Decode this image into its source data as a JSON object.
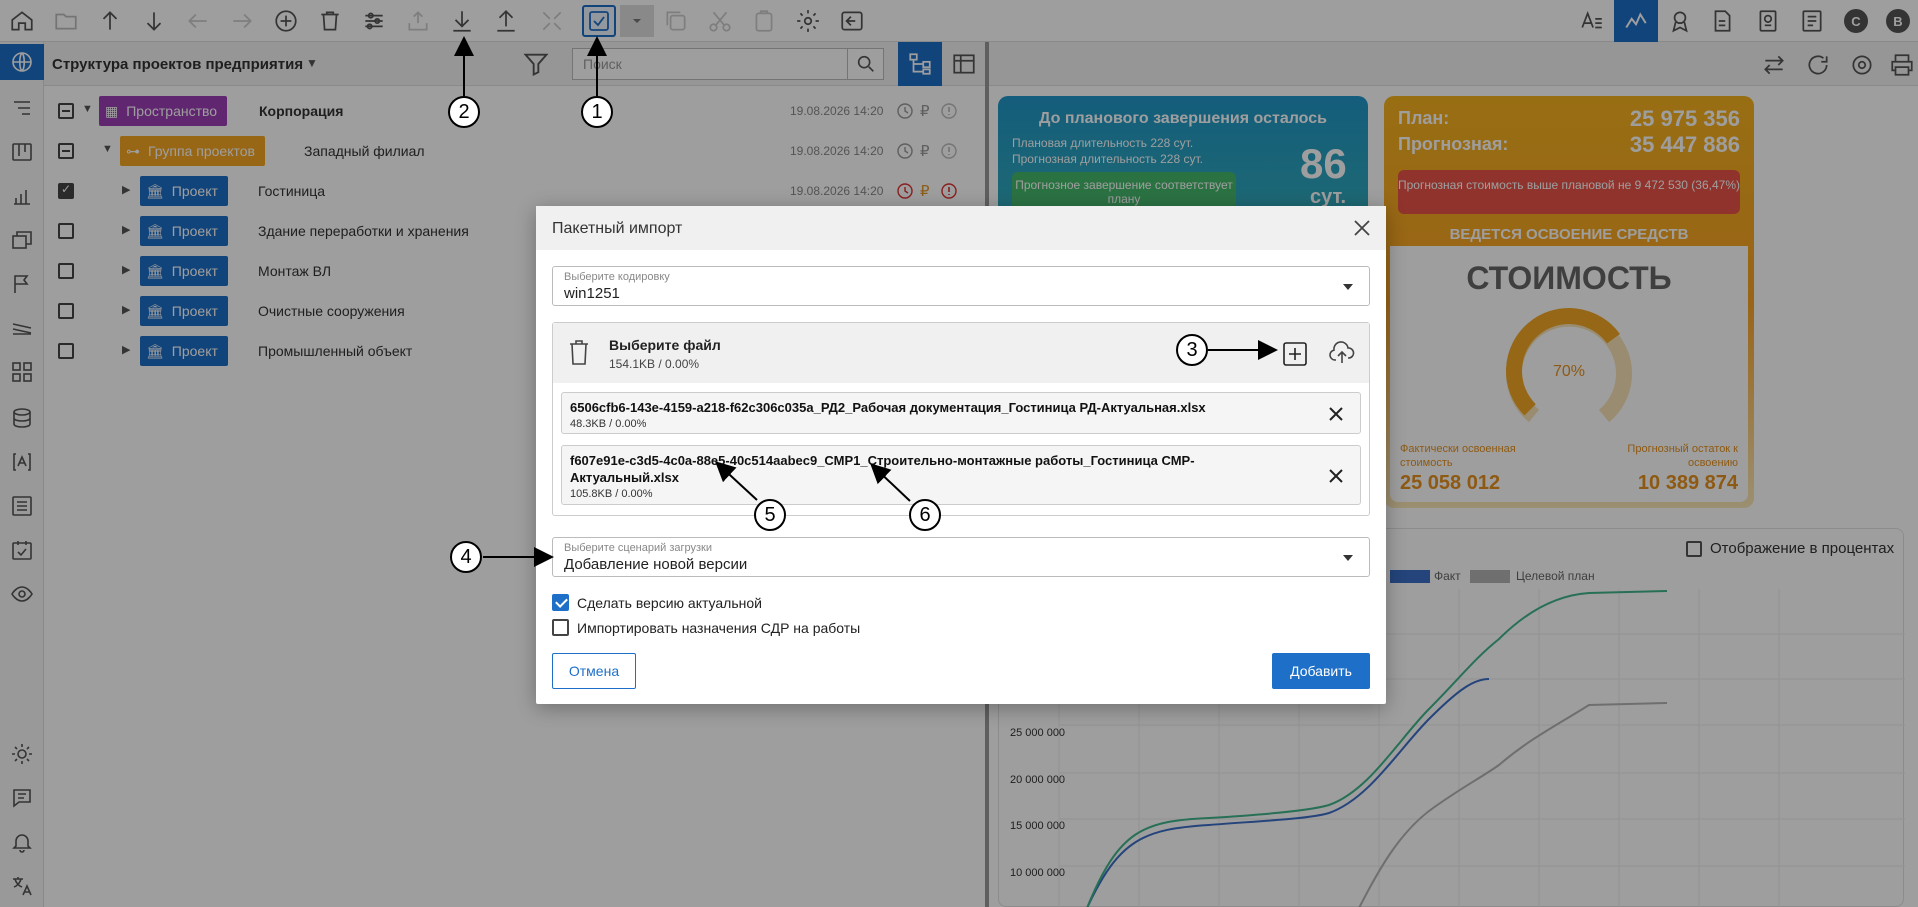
{
  "toolbar": {
    "icons": [
      "home-icon",
      "folder-icon",
      "arrow-up-icon",
      "arrow-down-icon",
      "arrow-left-icon",
      "arrow-right-icon",
      "add-circle-icon",
      "trash-icon",
      "settings-sliders-icon",
      "upload-tray-icon",
      "download-icon",
      "upload-icon",
      "collapse-icon",
      "checkbox-icon",
      "dropdown-icon",
      "copy-icon",
      "cut-icon",
      "paste-icon",
      "settings-gear-icon",
      "export-icon"
    ],
    "right_icons": [
      "font-size-icon",
      "analytics-icon",
      "award-icon",
      "document-icon",
      "certificate-icon",
      "report-icon"
    ],
    "user_letters": [
      "C",
      "B"
    ]
  },
  "left_panel": {
    "title": "Структура проектов предприятия",
    "search_placeholder": "Поиск"
  },
  "tree": [
    {
      "badge": "Пространство",
      "name": "Корпорация",
      "date": "19.08.2026 14:20"
    },
    {
      "badge": "Группа проектов",
      "name": "Западный филиал",
      "date": "19.08.2026 14:20"
    },
    {
      "badge": "Проект",
      "name": "Гостиница",
      "date": "19.08.2026 14:20"
    },
    {
      "badge": "Проект",
      "name": "Здание переработки и хранения"
    },
    {
      "badge": "Проект",
      "name": "Монтаж ВЛ"
    },
    {
      "badge": "Проект",
      "name": "Очистные сооружения"
    },
    {
      "badge": "Проект",
      "name": "Промышленный объект"
    }
  ],
  "card_schedule": {
    "title": "До планового завершения осталось",
    "line1": "Плановая длительность 228 сут.",
    "line2": "Прогнозная длительность 228 сут.",
    "big": "86",
    "unit": "сут.",
    "pill": "Прогнозное завершение соответствует плану"
  },
  "card_cost": {
    "plan_label": "План:",
    "plan_value": "25 975 356",
    "forecast_label": "Прогнозная:",
    "forecast_value": "35 447 886",
    "warning": "Прогнозная стоимость выше плановой не 9 472 530 (36,47%)",
    "status": "ВЕДЕТСЯ ОСВОЕНИЕ СРЕДСТВ",
    "heading": "СТОИМОСТЬ",
    "percent": "70%",
    "percent_value": 70,
    "fact_label": "Фактически освоенная стоимость",
    "fact_value": "25 058 012",
    "remain_label": "Прогнозный остаток к освоению",
    "remain_value": "10 389 874"
  },
  "chart_panel": {
    "percent_toggle": "Отображение в процентах",
    "legend_fact": "Факт",
    "legend_target": "Целевой план",
    "colors": {
      "fact": "#3b6fc7",
      "target": "#b3b3b3",
      "plan": "#3fb58a"
    }
  },
  "chart_data": {
    "type": "line",
    "y_ticks": [
      "25 000 000",
      "20 000 000",
      "15 000 000",
      "10 000 000"
    ],
    "series": [
      {
        "name": "Факт",
        "color": "#3b6fc7"
      },
      {
        "name": "Целевой план",
        "color": "#b3b3b3"
      }
    ]
  },
  "dialog": {
    "title": "Пакетный импорт",
    "encoding_label": "Выберите кодировку",
    "encoding_value": "win1251",
    "file_title": "Выберите файл",
    "file_total": "154.1KB / 0.00%",
    "files": [
      {
        "name": "6506cfb6-143e-4159-a218-f62c306c035a_РД2_Рабочая документация_Гостиница РД-Актуальная.xlsx",
        "size": "48.3KB / 0.00%"
      },
      {
        "name": "f607e91e-c3d5-4c0a-88e5-40c514aabec9_СМР1_Строительно-монтажные работы_Гостиница СМР-Актуальный.xlsx",
        "size": "105.8KB / 0.00%"
      }
    ],
    "scenario_label": "Выберите сценарий загрузки",
    "scenario_value": "Добавление новой версии",
    "check_actual": "Сделать версию актуальной",
    "check_assign": "Импортировать назначения СДР на работы",
    "cancel": "Отмена",
    "add": "Добавить"
  },
  "callouts": [
    "1",
    "2",
    "3",
    "4",
    "5",
    "6"
  ]
}
